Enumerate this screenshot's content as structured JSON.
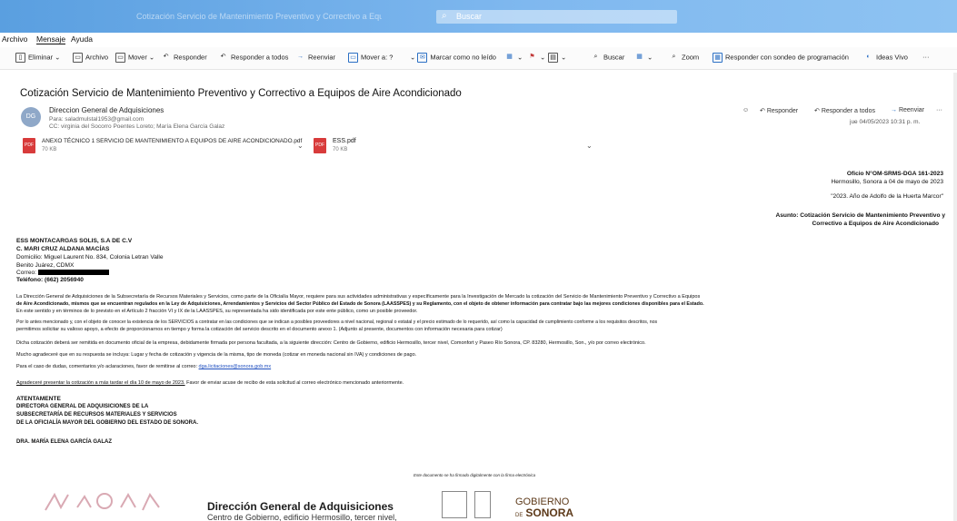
{
  "titlebar": {
    "window_title": "Cotización Servicio de Mantenimiento Preventivo y Correctivo a Equipos de Aire - Mensaje",
    "search_placeholder": "Buscar"
  },
  "menu": {
    "archivo": "Archivo",
    "mensaje": "Mensaje",
    "ayuda": "Ayuda"
  },
  "toolbar": {
    "eliminar": "Eliminar",
    "archivo": "Archivo",
    "mover": "Mover",
    "responder": "Responder",
    "responder_todos": "Responder a todos",
    "reenviar": "Reenviar",
    "mover_a": "Mover a: ?",
    "marcar": "Marcar como no leído",
    "buscar": "Buscar",
    "zoom": "Zoom",
    "responder_sondeo": "Responder con sondeo de programación",
    "ideas": "Ideas Vivo",
    "more": "···"
  },
  "email": {
    "subject": "Cotización Servicio de Mantenimiento Preventivo y Correctivo a Equipos de Aire Acondicionado",
    "avatar_initials": "DG",
    "sender": "Direccion General de Adquisiciones",
    "from": "Para: saladmulstal1953@gmail.com",
    "cc": "CC: virginia del Socorro Poentes Loreto; María Elena García Galaz",
    "actions": {
      "responder": "Responder",
      "responder_todos": "Responder a todos",
      "reenviar": "Reenviar",
      "more": "···"
    },
    "datetime": "jue 04/05/2023 10:31 p. m."
  },
  "attachments": [
    {
      "name": "ANEXO TÉCNICO 1 SERVICIO DE MANTENIMIENTO A EQUIPOS DE AIRE ACONDICIONADO.pdf",
      "size": "70 KB"
    },
    {
      "name": "ESS.pdf",
      "size": "70 KB"
    }
  ],
  "letter": {
    "oficio": "Oficio N°OM-SRMS-DGA 161-2023",
    "place_date": "Hermosillo, Sonora a 04 de mayo de 2023",
    "year_motto": "\"2023. Año de Adolfo de la Huerta Marcor\"",
    "asunto_line1": "Asunto: Cotización Servicio de Mantenimiento Preventivo y",
    "asunto_line2": "Correctivo a Equipos de Aire Acondicionado",
    "recipient_company": "ESS MONTACARGAS SOLIS, S.A DE C.V",
    "recipient_name": "C. MARI CRUZ ALDANA MACÍAS",
    "domicilio": "Domicilio: Miguel Laurent No. 834, Colonia Letran Valle",
    "city": "Benito Juárez, CDMX",
    "correo_label": "Correo:",
    "telefono": "Teléfono: (662) 2056940",
    "p1_l1": "La Dirección General de Adquisiciones de la Subsecretaría de Recursos Materiales y Servicios, como parte de la Oficialía Mayor, requiere para sus actividades administrativas y específicamente para la Investigación de Mercado la cotización del Servicio de Mantenimiento Preventivo y Correctivo a Equipos",
    "p1_l2": "de Aire Acondicionado, mismos que se encuentran regulados en la Ley de Adquisiciones, Arrendamientos y Servicios del Sector Público del Estado de Sonora (LAASSPES) y su Reglamento, con el objeto de obtener información para contratar bajo las mejores condiciones disponibles para el Estado.",
    "p1_l3": "En este sentido y en términos de lo previsto en el Artículo 2 fracción VI y IX de la LAASSPES, su representada ha sido identificada por este ente público, como un posible proveedor.",
    "p2_l1": "Por lo antes mencionado y, con el objeto de conocer la existencia de los SERVICIOS a contratar en las condiciones que se indican a posibles proveedores a nivel nacional, regional o estatal y el precio estimado de lo requerido, así como la capacidad de cumplimiento conforme a los requisitos descritos, nos",
    "p2_l2": "permitimos solicitar su valioso apoyo, a efecto de proporcionarnos en tiempo y forma la cotización del servicio descrito en el documento anexo 1. (Adjunto al presente, documentos con información necesaria para cotizar)",
    "p3": "Dicha cotización deberá ser remitida en documento oficial de la empresa, debidamente firmada por persona facultada, a la siguiente dirección: Centro de Gobierno, edificio Hermosillo, tercer nivel, Comonfort y Paseo Río Sonora, CP. 83280, Hermosillo, Son., y/o por correo electrónico.",
    "p4": "Mucho agradeceré que en su respuesta se incluya: Lugar y fecha de cotización y vigencia de la misma, tipo de moneda (cotizar en moneda nacional sin IVA) y condiciones de pago.",
    "p5_text": "Para el caso de dudas, comentarios y/o aclaraciones, favor de remitirse al correo:",
    "p5_email": "dga.licitaciones@sonora.gob.mx",
    "p6_underlined": "Agradeceré presentar la cotización a más tardar el día 10 de mayo de 2023.",
    "p6_rest": "Favor de enviar acuse de recibo de esta solicitud al correo electrónico mencionado anteriormente.",
    "atentamente": "ATENTAMENTE",
    "sig1": "DIRECTORA GENERAL DE ADQUISICIONES DE LA",
    "sig2": "SUBSECRETARÍA DE RECURSOS MATERIALES Y SERVICIOS",
    "sig3": "DE LA OFICIALÍA MAYOR DEL GOBIERNO DEL ESTADO DE SONORA.",
    "signer": "DRA. MARÍA ELENA GARCÍA GALAZ",
    "signature_note": "Este documento se ha firmado digitalmente con la firma electrónica"
  },
  "footer": {
    "title": "Dirección General de Adquisiciones",
    "subtitle": "Centro de Gobierno, edificio Hermosillo, tercer nivel,",
    "gob_line1": "GOBIERNO",
    "gob_line2": "SONORA",
    "gob_prefix": "DE"
  }
}
